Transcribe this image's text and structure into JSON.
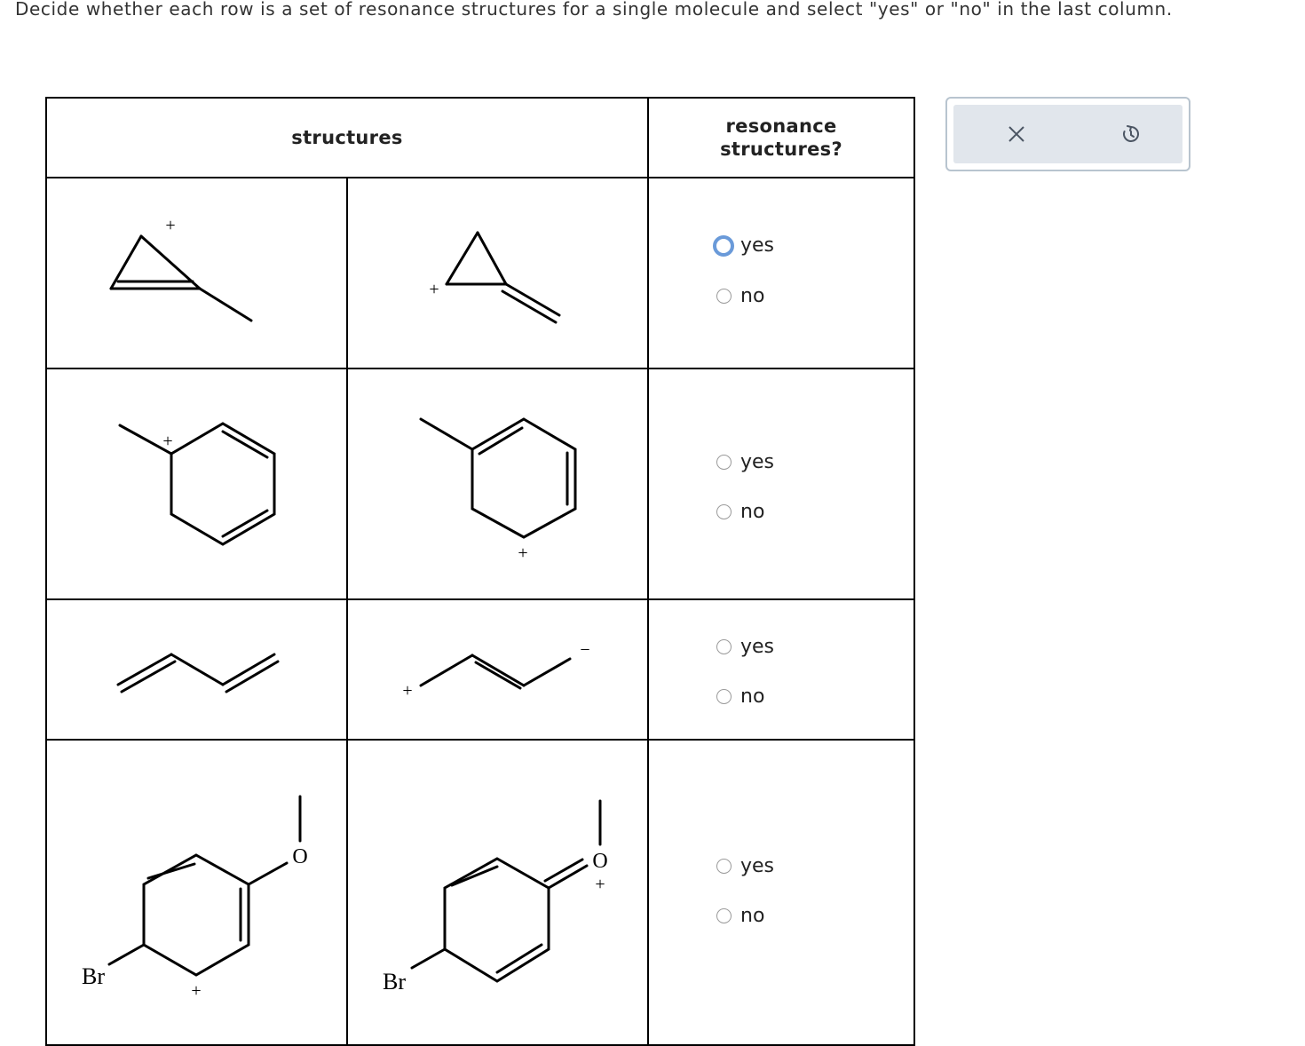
{
  "question": "Decide whether each row is a set of resonance structures for a single molecule and select \"yes\" or \"no\" in the last column.",
  "table": {
    "header_structures": "structures",
    "header_resonance": "resonance structures?",
    "options": {
      "yes": "yes",
      "no": "no"
    },
    "rows": [
      {
        "molecule": "methylcyclopropenyl cation vs methylenecyclopropyl cation",
        "selected": null,
        "focused_option": "yes"
      },
      {
        "molecule": "methylcyclohexadienyl cation pair",
        "selected": null
      },
      {
        "molecule": "butadiene vs butenyl cation/anion",
        "selected": null
      },
      {
        "molecule": "bromo-methoxy cyclohexadienyl cation pair",
        "selected": null
      }
    ],
    "atom_labels": {
      "bromine": "Br",
      "oxygen": "O",
      "plus": "+",
      "minus": "−"
    }
  },
  "toolbar": {
    "close_icon": "x-icon",
    "reset_icon": "undo-icon"
  }
}
